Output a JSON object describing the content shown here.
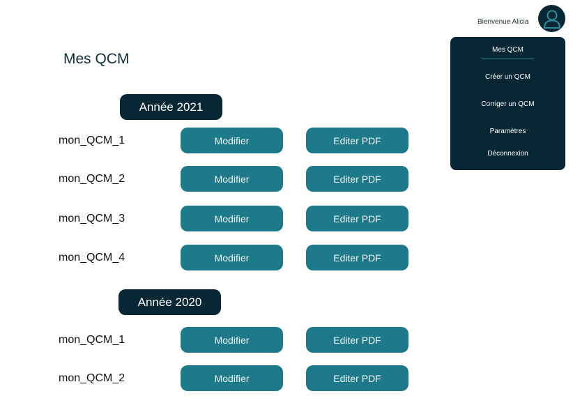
{
  "header": {
    "welcome": "Bienvenue Alicia"
  },
  "page_title": "Mes QCM",
  "menu": {
    "items": [
      {
        "label": "Mes QCM",
        "active": true
      },
      {
        "label": "Créer un QCM"
      },
      {
        "label": "Corriger un QCM"
      },
      {
        "label": "Paramètres"
      },
      {
        "label": "Déconnexion"
      }
    ]
  },
  "years": [
    {
      "label": "Année 2021",
      "qcms": [
        {
          "name": "mon_QCM_1",
          "modify": "Modifier",
          "pdf": "Editer PDF"
        },
        {
          "name": "mon_QCM_2",
          "modify": "Modifier",
          "pdf": "Editer PDF"
        },
        {
          "name": "mon_QCM_3",
          "modify": "Modifier",
          "pdf": "Editer PDF"
        },
        {
          "name": "mon_QCM_4",
          "modify": "Modifier",
          "pdf": "Editer PDF"
        }
      ]
    },
    {
      "label": "Année 2020",
      "qcms": [
        {
          "name": "mon_QCM_1",
          "modify": "Modifier",
          "pdf": "Editer PDF"
        },
        {
          "name": "mon_QCM_2",
          "modify": "Modifier",
          "pdf": "Editer PDF"
        }
      ]
    }
  ],
  "colors": {
    "dark": "#062733",
    "accent": "#1e7a8a"
  },
  "icons": {
    "avatar": "user-icon"
  }
}
